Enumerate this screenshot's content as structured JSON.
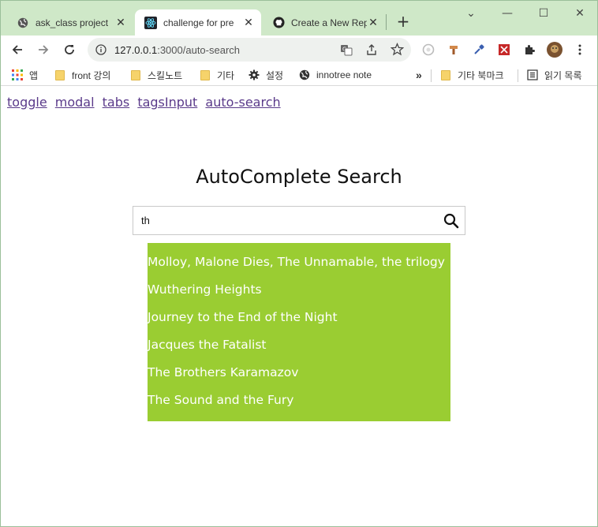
{
  "browser": {
    "tabs": [
      {
        "title": "ask_class project",
        "favicon": "globe-icon"
      },
      {
        "title": "challenge for pre",
        "favicon": "react-icon",
        "active": true
      },
      {
        "title": "Create a New Rep",
        "favicon": "github-icon"
      }
    ],
    "url_host": "127.0.0.1",
    "url_rest": ":3000/auto-search",
    "bookmarks": [
      {
        "label": "앱",
        "icon": "apps-grid-icon"
      },
      {
        "label": "front 강의",
        "icon": "folder-icon"
      },
      {
        "label": "스킬노트",
        "icon": "folder-icon"
      },
      {
        "label": "기타",
        "icon": "folder-icon"
      },
      {
        "label": "설정",
        "icon": "gear-icon"
      },
      {
        "label": "innotree note",
        "icon": "globe-icon"
      }
    ],
    "bookmarks_overflow": "»",
    "other_bookmarks": "기타 북마크",
    "reading_list": "읽기 목록"
  },
  "page": {
    "nav_links": [
      "toggle",
      "modal",
      "tabs",
      "tagsInput",
      "auto-search"
    ],
    "title": "AutoComplete Search",
    "search_value": "th",
    "results": [
      "Molloy, Malone Dies, The Unnamable, the trilogy",
      "Wuthering Heights",
      "Journey to the End of the Night",
      "Jacques the Fatalist",
      "The Brothers Karamazov",
      "The Sound and the Fury"
    ]
  },
  "colors": {
    "tabstrip": "#cfe8c8",
    "results_bg": "#9acd32",
    "link": "#5a3a8a"
  }
}
